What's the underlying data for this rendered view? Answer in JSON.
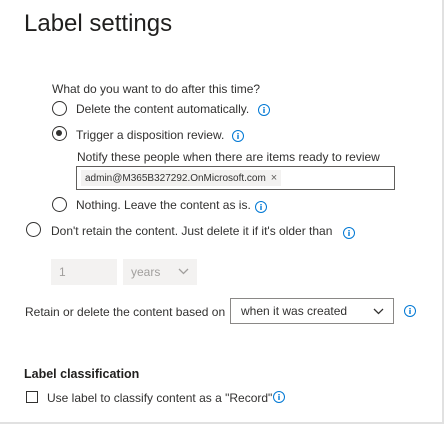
{
  "page": {
    "title": "Label settings"
  },
  "retention": {
    "question": "What do you want to do after this time?",
    "options": [
      {
        "label": "Delete the content automatically.",
        "selected": false
      },
      {
        "label": "Trigger a disposition review.",
        "selected": true
      },
      {
        "label": "Nothing. Leave the content as is.",
        "selected": false
      }
    ],
    "notify_label": "Notify these people when there are items ready to review",
    "notify_chip": "admin@M365B327292.OnMicrosoft.com",
    "delete_only_label": "Don't retain the content. Just delete it if it's older than",
    "duration_value": "1",
    "duration_unit": "years",
    "based_on_label": "Retain or delete the content based on",
    "based_on_value": "when it was created"
  },
  "classification": {
    "heading": "Label classification",
    "record_checkbox_label": "Use label to classify content as a \"Record\"",
    "record_checked": false
  },
  "colors": {
    "info": "#0078d4",
    "text": "#323130",
    "disabled_bg": "#f3f2f1"
  },
  "icons": {
    "info": "info-icon",
    "chevron": "chevron-down-icon",
    "remove": "close-icon"
  }
}
